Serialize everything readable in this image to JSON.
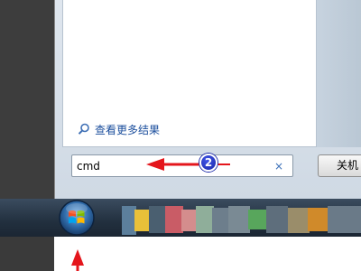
{
  "start_menu": {
    "more_results_label": "查看更多结果",
    "search": {
      "value": "cmd",
      "clear_glyph": "×"
    },
    "shutdown_label": "关机"
  },
  "annotation": {
    "step_number": "2",
    "arrow_color": "#e4161c"
  },
  "icons": [
    "magnifier-icon",
    "clear-search-icon",
    "windows-start-orb-icon"
  ],
  "colors": {
    "link": "#1a4d9c",
    "taskbar": "#22303f",
    "badge": "#1b28a8"
  }
}
